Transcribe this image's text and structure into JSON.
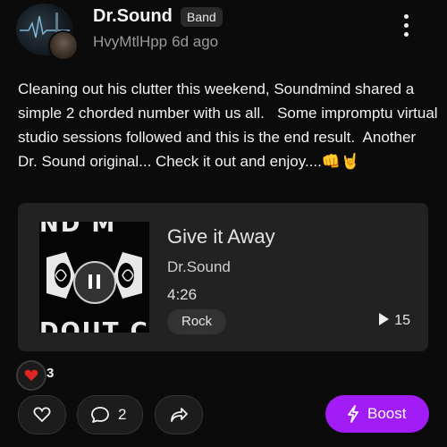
{
  "post": {
    "author": "Dr.Sound",
    "badge": "Band",
    "posted_by": "HvyMtlHpp",
    "time_ago": "6d ago",
    "text": "Cleaning out his clutter this weekend, Soundmind shared a simple 2 chorded number with us all.   Some impromptu virtual studio sessions followed and this is the end result.  Another Dr. Sound original... Check it out and enjoy....👊🤘"
  },
  "track": {
    "cover_text_top": "ND  M",
    "cover_text_bottom": "DOUT C",
    "title": "Give it Away",
    "artist": "Dr.Sound",
    "duration": "4:26",
    "genre": "Rock",
    "plays": "15"
  },
  "reactions": {
    "count": "3",
    "icon": "heart-icon",
    "color": "#e02424"
  },
  "actions": {
    "comments_count": "2",
    "boost_label": "Boost",
    "boost_color": "#a21cf6"
  }
}
